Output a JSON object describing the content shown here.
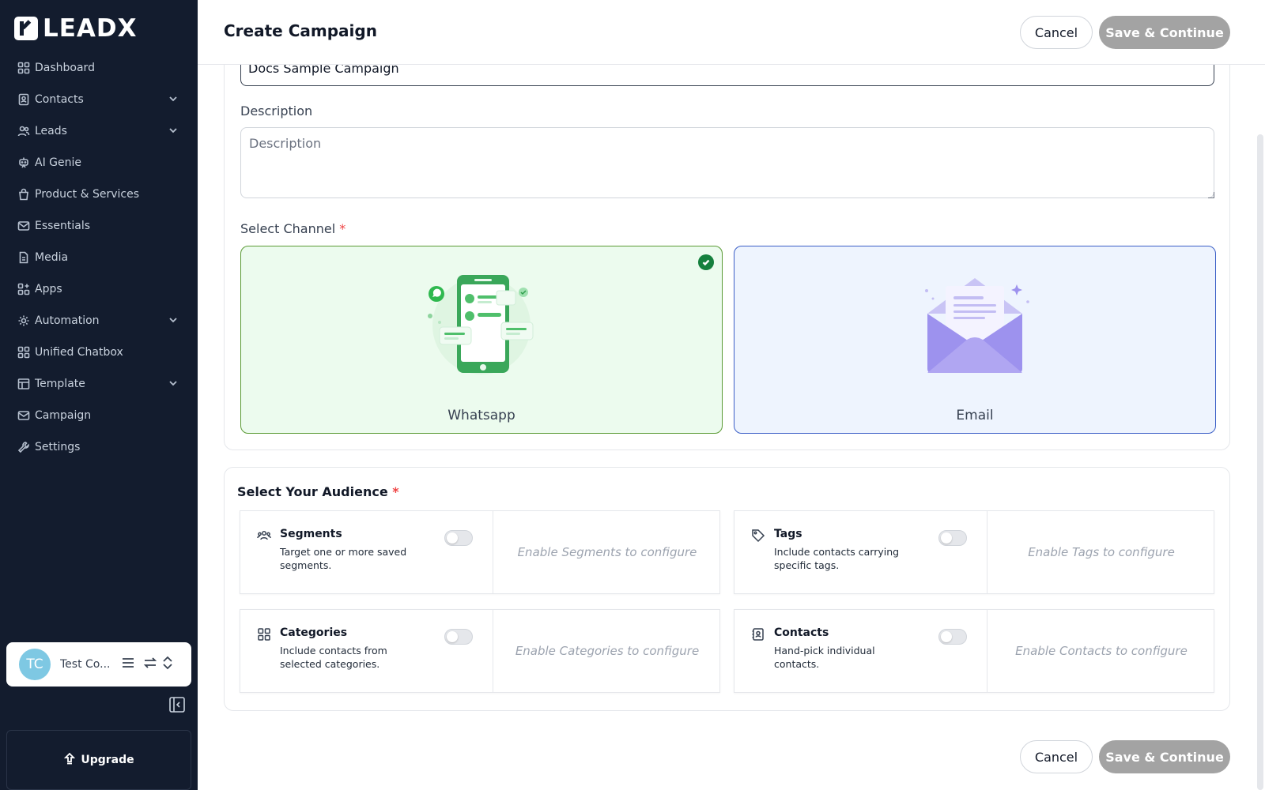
{
  "brand": {
    "name": "LEADX"
  },
  "sidebar": {
    "items": [
      {
        "label": "Dashboard",
        "icon": "grid-icon",
        "expandable": false
      },
      {
        "label": "Contacts",
        "icon": "contacts-icon",
        "expandable": true
      },
      {
        "label": "Leads",
        "icon": "users-icon",
        "expandable": true
      },
      {
        "label": "AI Genie",
        "icon": "robot-icon",
        "expandable": false
      },
      {
        "label": "Product & Services",
        "icon": "bag-icon",
        "expandable": false
      },
      {
        "label": "Essentials",
        "icon": "mail-icon",
        "expandable": false
      },
      {
        "label": "Media",
        "icon": "file-icon",
        "expandable": false
      },
      {
        "label": "Apps",
        "icon": "apps-icon",
        "expandable": false
      },
      {
        "label": "Automation",
        "icon": "gear-icon",
        "expandable": true
      },
      {
        "label": "Unified Chatbox",
        "icon": "grid-icon",
        "expandable": false
      },
      {
        "label": "Template",
        "icon": "template-icon",
        "expandable": true
      },
      {
        "label": "Campaign",
        "icon": "campaign-mail-icon",
        "expandable": false
      },
      {
        "label": "Settings",
        "icon": "wrench-icon",
        "expandable": false
      }
    ],
    "user": {
      "initials": "TC",
      "name": "Test Co..."
    },
    "upgrade_label": "Upgrade"
  },
  "header": {
    "title": "Create Campaign",
    "cancel_label": "Cancel",
    "save_label": "Save & Continue"
  },
  "form": {
    "name_value": "Docs Sample Campaign",
    "description_label": "Description",
    "description_placeholder": "Description",
    "channel_label": "Select Channel",
    "required_mark": "*",
    "channels": [
      {
        "label": "Whatsapp",
        "selected": true
      },
      {
        "label": "Email",
        "selected": false
      }
    ]
  },
  "audience": {
    "title": "Select Your Audience",
    "required_mark": "*",
    "options": [
      {
        "name": "Segments",
        "description": "Target one or more saved segments.",
        "placeholder": "Enable Segments to configure",
        "enabled": false,
        "icon": "segments-icon"
      },
      {
        "name": "Tags",
        "description": "Include contacts carrying specific tags.",
        "placeholder": "Enable Tags to configure",
        "enabled": false,
        "icon": "tag-icon"
      },
      {
        "name": "Categories",
        "description": "Include contacts from selected categories.",
        "placeholder": "Enable Categories to configure",
        "enabled": false,
        "icon": "categories-icon"
      },
      {
        "name": "Contacts",
        "description": "Hand-pick individual contacts.",
        "placeholder": "Enable Contacts to configure",
        "enabled": false,
        "icon": "contact-card-icon"
      }
    ]
  },
  "footer": {
    "cancel_label": "Cancel",
    "save_label": "Save & Continue"
  },
  "colors": {
    "sidebar_bg": "#131c2e",
    "whatsapp_green": "#15803d",
    "email_blue": "#3b5fc7",
    "disabled_button": "#a3a3a3"
  }
}
